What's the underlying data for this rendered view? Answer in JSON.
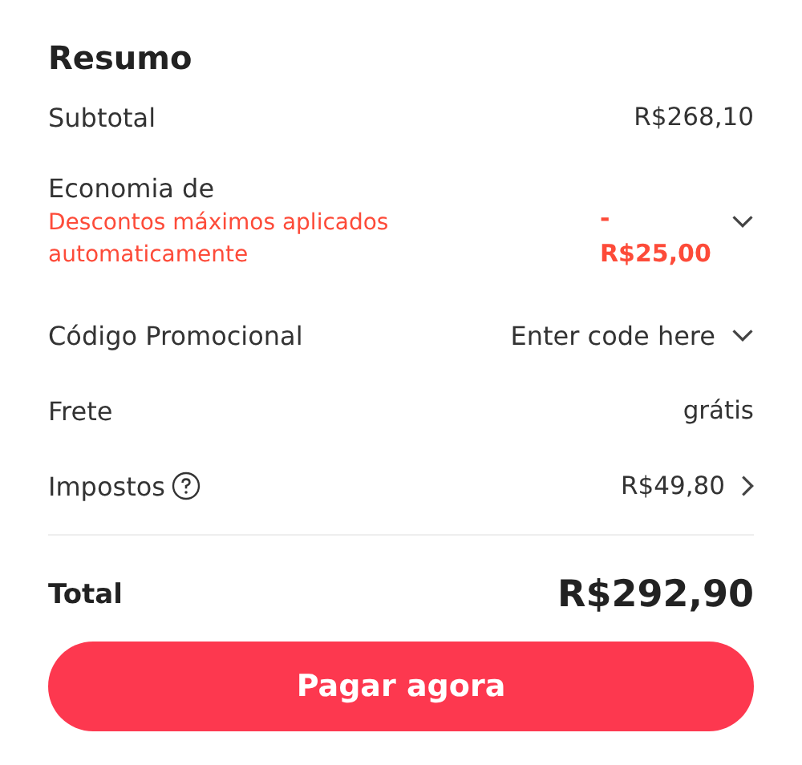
{
  "title": "Resumo",
  "rows": [
    {
      "kind": "plain",
      "label": "Subtotal",
      "value": "R$268,10"
    },
    {
      "kind": "discount",
      "label": "Economia de",
      "note": "Descontos máximos aplicados automaticamente",
      "value": "- R$25,00",
      "dropdown": true
    },
    {
      "kind": "promo",
      "label": "Código Promocional",
      "value": "Enter code here",
      "dropdown": true
    },
    {
      "kind": "plain",
      "label": "Frete",
      "value": "grátis"
    },
    {
      "kind": "plain",
      "label": "Impostos",
      "help": true,
      "value": "R$49,80",
      "link": true
    }
  ],
  "total": {
    "label": "Total",
    "value": "R$292,90"
  },
  "pay_button": "Pagar agora"
}
